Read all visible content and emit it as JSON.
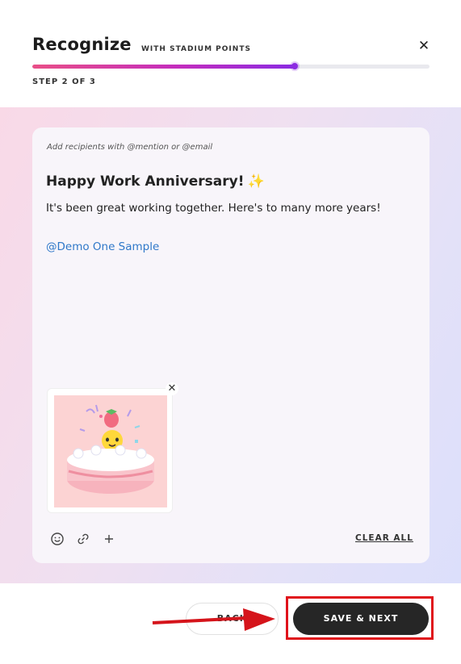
{
  "header": {
    "title": "Recognize",
    "subtitle": "WITH STADIUM POINTS",
    "step_label": "STEP 2 OF 3",
    "close_icon": "close-icon",
    "progress": 0.66
  },
  "composer": {
    "hint": "Add recipients with @mention or @email",
    "message_title": "Happy Work Anniversary!",
    "sparkle": "✨",
    "message_body": "It's been great working together. Here's to many more years!",
    "mention": "@Demo One Sample",
    "attachment": {
      "type": "gif",
      "icon": "cake-gif",
      "remove_icon": "close-icon"
    },
    "toolbar": {
      "emoji_icon": "emoji-icon",
      "link_icon": "link-icon",
      "add_icon": "plus-icon",
      "clear_all_label": "CLEAR ALL"
    }
  },
  "footer": {
    "back_label": "BACK",
    "save_label": "SAVE & NEXT"
  },
  "colors": {
    "accent_start": "#e94f87",
    "accent_end": "#8b2be2",
    "highlight": "#e0131b",
    "primary_button": "#262626"
  }
}
